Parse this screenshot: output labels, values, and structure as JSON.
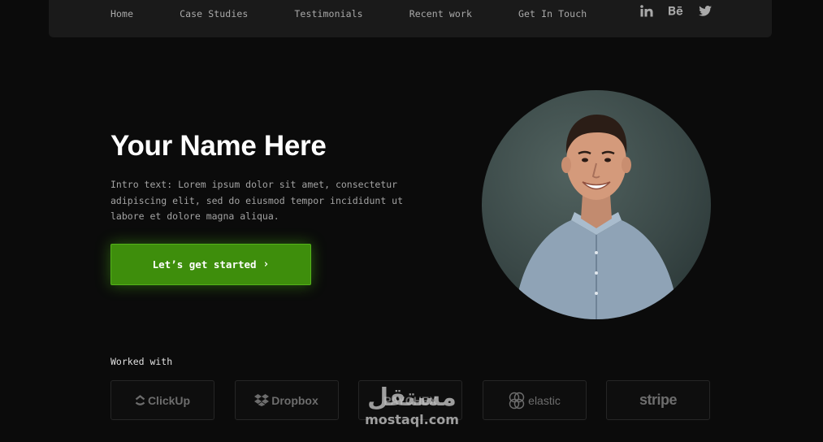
{
  "nav": {
    "links": [
      "Home",
      "Case Studies",
      "Testimonials",
      "Recent work",
      "Get In Touch"
    ],
    "social": [
      "linkedin-icon",
      "behance-icon",
      "twitter-icon"
    ]
  },
  "hero": {
    "title": "Your Name Here",
    "intro": "Intro text: Lorem ipsum dolor sit amet, consectetur adipiscing elit, sed do eiusmod tempor incididunt ut labore et dolore magna aliqua.",
    "cta_label": "Let’s get started",
    "cta_chevron": "›",
    "accent_color": "#3e8e0c"
  },
  "clients": {
    "label": "Worked with",
    "logos": [
      "ClickUp",
      "Dropbox",
      "PAYCHEX",
      "elastic",
      "stripe"
    ]
  },
  "watermark": {
    "arabic": "مستقل",
    "latin": "mostaql.com"
  }
}
